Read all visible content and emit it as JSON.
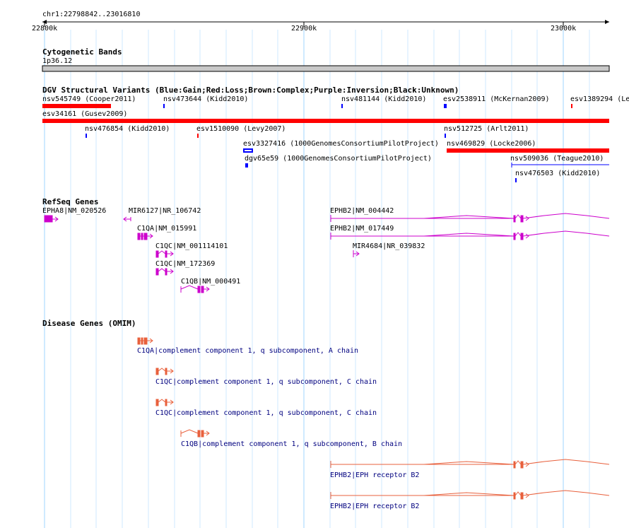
{
  "region": {
    "label": "chr1:22798842..23016810",
    "ticks": [
      "22800k",
      "22900k",
      "23000k"
    ]
  },
  "tracks": {
    "cytoband": {
      "title": "Cytogenetic Bands",
      "band": "1p36.12"
    },
    "dgv": {
      "title": "DGV Structural Variants (Blue:Gain;Red:Loss;Brown:Complex;Purple:Inversion;Black:Unknown)",
      "features": [
        {
          "label": "nsv545749 (Cooper2011)",
          "color": "#ff0000"
        },
        {
          "label": "nsv473644 (Kidd2010)",
          "color": "#0000ff"
        },
        {
          "label": "nsv481144 (Kidd2010)",
          "color": "#0000ff"
        },
        {
          "label": "esv2538911 (McKernan2009)",
          "color": "#0000ff"
        },
        {
          "label": "esv1389294 (Le",
          "color": "#ff0000"
        },
        {
          "label": "esv34161 (Gusev2009)",
          "color": "#ff0000"
        },
        {
          "label": "nsv476854 (Kidd2010)",
          "color": "#0000ff"
        },
        {
          "label": "esv1510090 (Levy2007)",
          "color": "#ff0000"
        },
        {
          "label": "nsv512725 (Arlt2011)",
          "color": "#0000ff"
        },
        {
          "label": "esv3327416 (1000GenomesConsortiumPilotProject)",
          "color": "#0000ff"
        },
        {
          "label": "nsv469829 (Locke2006)",
          "color": "#ff0000"
        },
        {
          "label": "dgv65e59 (1000GenomesConsortiumPilotProject)",
          "color": "#0000ff"
        },
        {
          "label": "nsv509036 (Teague2010)",
          "color": "#0000ff"
        },
        {
          "label": "nsv476503 (Kidd2010)",
          "color": "#0000ff"
        }
      ]
    },
    "refseq": {
      "title": "RefSeq Genes",
      "color": "#cc00cc",
      "genes": [
        {
          "label": "EPHA8|NM_020526"
        },
        {
          "label": "MIR6127|NR_106742"
        },
        {
          "label": "C1QA|NM_015991"
        },
        {
          "label": "C1QC|NM_001114101"
        },
        {
          "label": "C1QC|NM_172369"
        },
        {
          "label": "C1QB|NM_000491"
        },
        {
          "label": "EPHB2|NM_004442"
        },
        {
          "label": "EPHB2|NM_017449"
        },
        {
          "label": "MIR4684|NR_039832"
        }
      ]
    },
    "omim": {
      "title": "Disease Genes (OMIM)",
      "color": "#e8603c",
      "genes": [
        {
          "label": "C1QA|complement component 1, q subcomponent, A chain"
        },
        {
          "label": "C1QC|complement component 1, q subcomponent, C chain"
        },
        {
          "label": "C1QC|complement component 1, q subcomponent, C chain"
        },
        {
          "label": "C1QB|complement component 1, q subcomponent, B chain"
        },
        {
          "label": "EPHB2|EPH receptor B2"
        },
        {
          "label": "EPHB2|EPH receptor B2"
        }
      ]
    }
  }
}
